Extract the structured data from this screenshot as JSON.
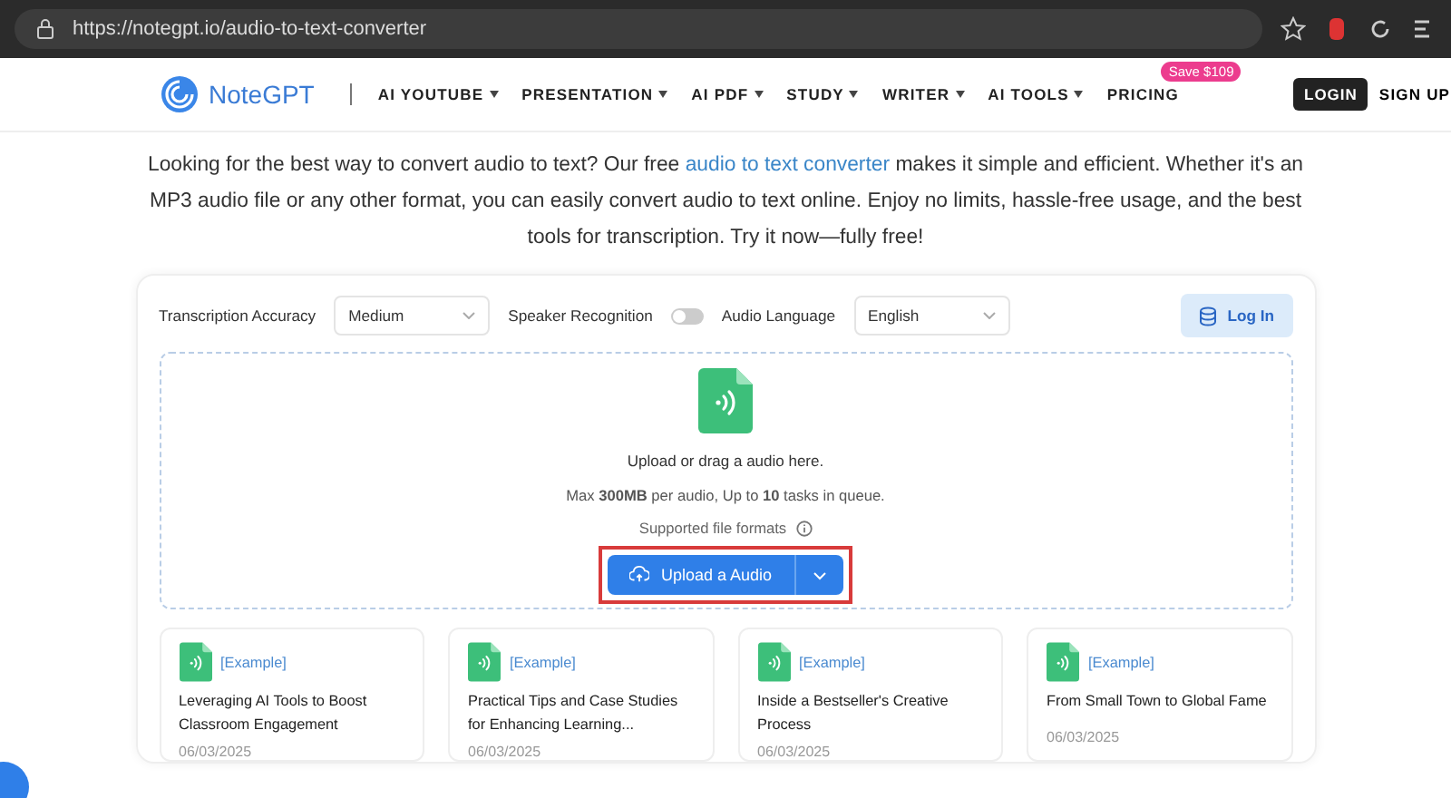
{
  "browser": {
    "url": "https://notegpt.io/audio-to-text-converter"
  },
  "nav": {
    "brand": "NoteGPT",
    "items": [
      {
        "label": "AI YOUTUBE",
        "dropdown": true
      },
      {
        "label": "PRESENTATION",
        "dropdown": true
      },
      {
        "label": "AI PDF",
        "dropdown": true
      },
      {
        "label": "STUDY",
        "dropdown": true
      },
      {
        "label": "WRITER",
        "dropdown": true
      },
      {
        "label": "AI TOOLS",
        "dropdown": true
      },
      {
        "label": "PRICING",
        "dropdown": false,
        "badge": "Save $109"
      }
    ],
    "login": "LOGIN",
    "signup": "SIGN UP"
  },
  "intro": {
    "before": "Looking for the best way to convert audio to text? Our free ",
    "link": "audio to text converter",
    "after": " makes it simple and efficient. Whether it's an MP3 audio file or any other format, you can easily convert audio to text online. Enjoy no limits, hassle-free usage, and the best tools for transcription. Try it now—fully free!"
  },
  "options": {
    "accuracy_label": "Transcription Accuracy",
    "accuracy": "Medium",
    "speaker_label": "Speaker Recognition",
    "speaker_on": false,
    "language_label": "Audio Language",
    "language": "English",
    "login_button": "Log In"
  },
  "upload": {
    "title": "Upload or drag a audio here.",
    "limits": "Max **300MB** per audio, Up to **10** tasks in queue.",
    "formats": "Supported file formats",
    "button": "Upload a Audio",
    "highlighted": true
  },
  "examples": [
    {
      "tag": "[Example]",
      "title": "Leveraging AI Tools to Boost Classroom Engagement",
      "date": "06/03/2025"
    },
    {
      "tag": "[Example]",
      "title": "Practical Tips and Case Studies for Enhancing Learning...",
      "date": "06/03/2025"
    },
    {
      "tag": "[Example]",
      "title": "Inside a Bestseller's Creative Process",
      "date": "06/03/2025"
    },
    {
      "tag": "[Example]",
      "title": "From Small Town to Global Fame",
      "date": "06/03/2025"
    }
  ]
}
